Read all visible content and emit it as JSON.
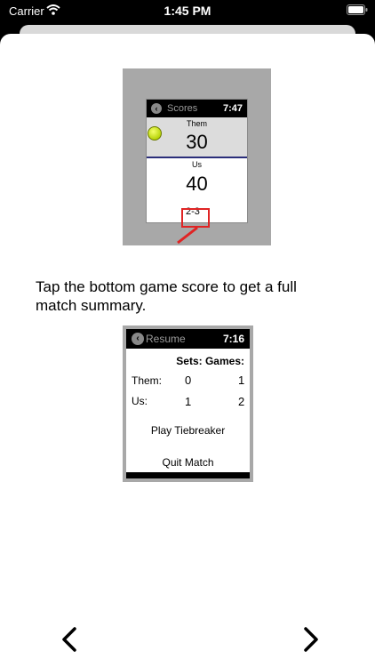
{
  "status_bar": {
    "carrier": "Carrier",
    "time": "1:45 PM"
  },
  "watch_scores": {
    "header_title": "Scores",
    "header_time": "7:47",
    "them_label": "Them",
    "them_score": "30",
    "us_label": "Us",
    "us_score": "40",
    "game_score": "2-3"
  },
  "instruction": "Tap the bottom game score to get a full match summary.",
  "watch_summary": {
    "header_title": "Resume",
    "header_time": "7:16",
    "columns_label": "Sets: Games:",
    "rows": [
      {
        "label": "Them:",
        "sets": "0",
        "games": "1"
      },
      {
        "label": "Us:",
        "sets": "1",
        "games": "2"
      }
    ],
    "buttons": [
      "Play Tiebreaker",
      "Quit Match"
    ]
  },
  "colors": {
    "accent_red": "#e02424",
    "divider_blue": "#2b2e7a",
    "ball_yellow": "#c8e01a"
  },
  "icons": {
    "prev": "chevron-left-icon",
    "next": "chevron-right-icon",
    "wifi": "wifi-icon",
    "battery": "battery-icon",
    "back": "back-circle-icon",
    "ball": "tennis-ball-icon"
  }
}
